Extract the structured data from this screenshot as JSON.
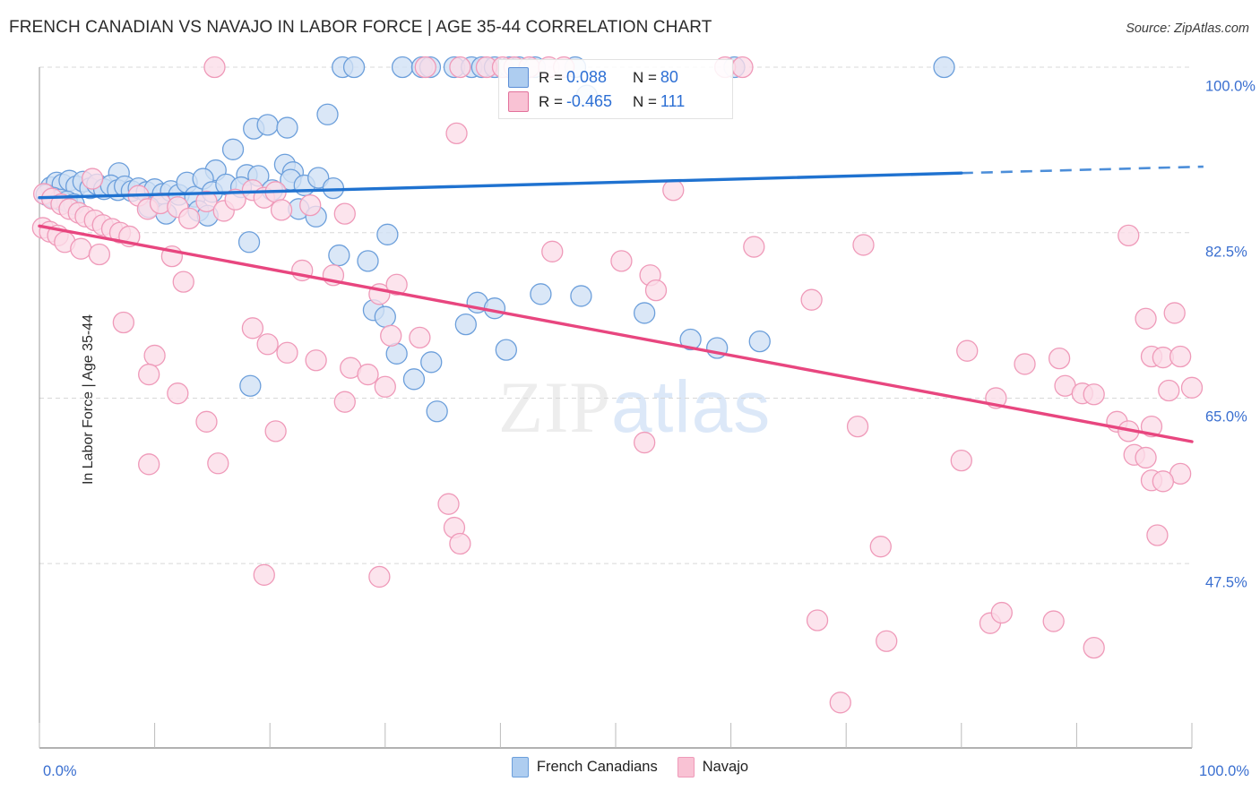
{
  "header": {
    "title": "FRENCH CANADIAN VS NAVAJO IN LABOR FORCE | AGE 35-44 CORRELATION CHART",
    "source": "Source: ZipAtlas.com"
  },
  "watermark": {
    "part1": "ZIP",
    "part2": "atlas"
  },
  "stats_legend": {
    "rows": [
      {
        "swatch": "blue-swatch",
        "r_label": "R =",
        "r_value": "0.088",
        "n_label": "N =",
        "n_value": "80"
      },
      {
        "swatch": "pink-swatch",
        "r_label": "R =",
        "r_value": "-0.465",
        "n_label": "N =",
        "n_value": "111"
      }
    ]
  },
  "series_legend": [
    {
      "name": "French Canadians",
      "color": "#aecdf0"
    },
    {
      "name": "Navajo",
      "color": "#f9c2d4"
    }
  ],
  "colors": {
    "blue_fill": "#cfe0f5",
    "blue_stroke": "#6c9fdb",
    "pink_fill": "#fbdde8",
    "pink_stroke": "#ef9ab9",
    "blue_line": "#1f72d0",
    "pink_line": "#e8467f",
    "axis_label": "#3a6fd0",
    "gridline": "#d8d8d8"
  },
  "chart_data": {
    "type": "scatter",
    "title": "FRENCH CANADIAN VS NAVAJO IN LABOR FORCE | AGE 35-44 CORRELATION CHART",
    "xlabel": "",
    "ylabel": "In Labor Force | Age 35-44",
    "xlim": [
      0,
      100
    ],
    "ylim": [
      28.0,
      100.0
    ],
    "x_tick_labels": [
      "0.0%",
      "100.0%"
    ],
    "y_tick_labels": [
      "100.0%",
      "82.5%",
      "65.0%",
      "47.5%"
    ],
    "y_ticks": [
      100.0,
      82.5,
      65.0,
      47.5
    ],
    "grid": true,
    "legend_position": "bottom-center",
    "series": [
      {
        "name": "French Canadians",
        "color": "#cfe0f5",
        "stroke": "#6c9fdb",
        "R": 0.088,
        "N": 80,
        "trendline": {
          "x0": 0,
          "y0": 86.2,
          "x1": 80,
          "y1": 88.8,
          "dashed_from_x": 80,
          "x_dash_end": 101
        },
        "points": [
          [
            26.3,
            100.0
          ],
          [
            27.3,
            100.0
          ],
          [
            31.5,
            100.0
          ],
          [
            33.2,
            100.0
          ],
          [
            33.9,
            100.0
          ],
          [
            36.0,
            100.0
          ],
          [
            37.5,
            100.0
          ],
          [
            38.4,
            100.0
          ],
          [
            39.5,
            100.0
          ],
          [
            40.8,
            100.0
          ],
          [
            41.6,
            100.0
          ],
          [
            43.0,
            100.0
          ],
          [
            46.5,
            100.0
          ],
          [
            60.3,
            100.0
          ],
          [
            78.5,
            100.0
          ],
          [
            47.5,
            97.0
          ],
          [
            18.6,
            93.5
          ],
          [
            19.8,
            93.9
          ],
          [
            21.5,
            93.6
          ],
          [
            25.0,
            95.0
          ],
          [
            16.8,
            91.3
          ],
          [
            21.3,
            89.7
          ],
          [
            15.3,
            89.1
          ],
          [
            18.0,
            88.6
          ],
          [
            22.0,
            88.9
          ],
          [
            6.9,
            88.8
          ],
          [
            1.0,
            87.3
          ],
          [
            1.5,
            87.8
          ],
          [
            2.0,
            87.6
          ],
          [
            2.6,
            88.0
          ],
          [
            3.2,
            87.4
          ],
          [
            3.8,
            87.9
          ],
          [
            4.4,
            87.2
          ],
          [
            5.0,
            87.6
          ],
          [
            5.6,
            87.1
          ],
          [
            6.2,
            87.5
          ],
          [
            6.8,
            87.0
          ],
          [
            7.4,
            87.4
          ],
          [
            8.0,
            86.9
          ],
          [
            8.6,
            87.2
          ],
          [
            9.3,
            86.8
          ],
          [
            10.0,
            87.1
          ],
          [
            10.7,
            86.6
          ],
          [
            11.4,
            86.9
          ],
          [
            12.1,
            86.5
          ],
          [
            12.8,
            87.8
          ],
          [
            13.5,
            86.3
          ],
          [
            14.2,
            88.2
          ],
          [
            15.0,
            86.8
          ],
          [
            16.2,
            87.6
          ],
          [
            17.5,
            87.3
          ],
          [
            19.0,
            88.5
          ],
          [
            20.2,
            87.0
          ],
          [
            21.8,
            88.1
          ],
          [
            23.0,
            87.5
          ],
          [
            24.2,
            88.3
          ],
          [
            25.5,
            87.2
          ],
          [
            0.6,
            86.5
          ],
          [
            1.2,
            86.2
          ],
          [
            1.8,
            86.0
          ],
          [
            2.4,
            85.8
          ],
          [
            3.0,
            85.5
          ],
          [
            9.5,
            85.2
          ],
          [
            11.0,
            84.5
          ],
          [
            13.8,
            84.8
          ],
          [
            14.6,
            84.3
          ],
          [
            22.5,
            85.0
          ],
          [
            24.0,
            84.2
          ],
          [
            18.2,
            81.5
          ],
          [
            26.0,
            80.1
          ],
          [
            28.5,
            79.5
          ],
          [
            30.2,
            82.3
          ],
          [
            38.0,
            75.1
          ],
          [
            39.5,
            74.5
          ],
          [
            29.0,
            74.3
          ],
          [
            30.0,
            73.6
          ],
          [
            37.0,
            72.8
          ],
          [
            40.5,
            70.1
          ],
          [
            31.0,
            69.7
          ],
          [
            34.0,
            68.8
          ],
          [
            32.5,
            67.0
          ],
          [
            58.8,
            70.3
          ],
          [
            34.5,
            63.6
          ],
          [
            18.3,
            66.3
          ],
          [
            43.5,
            76.0
          ],
          [
            47.0,
            75.8
          ],
          [
            52.5,
            74.0
          ],
          [
            56.5,
            71.2
          ],
          [
            62.5,
            71.0
          ]
        ]
      },
      {
        "name": "Navajo",
        "color": "#fbdde8",
        "stroke": "#ef9ab9",
        "R": -0.465,
        "N": 111,
        "trendline": {
          "x0": 0,
          "y0": 83.2,
          "x1": 100,
          "y1": 60.4
        },
        "points": [
          [
            15.2,
            100.0
          ],
          [
            33.5,
            100.0
          ],
          [
            36.5,
            100.0
          ],
          [
            38.8,
            100.0
          ],
          [
            40.2,
            100.0
          ],
          [
            41.2,
            100.0
          ],
          [
            42.5,
            100.0
          ],
          [
            44.2,
            100.0
          ],
          [
            45.5,
            100.0
          ],
          [
            59.5,
            100.0
          ],
          [
            61.0,
            100.0
          ],
          [
            36.2,
            93.0
          ],
          [
            0.4,
            86.6
          ],
          [
            1.1,
            86.1
          ],
          [
            1.9,
            85.5
          ],
          [
            4.6,
            88.2
          ],
          [
            2.6,
            85.0
          ],
          [
            3.4,
            84.6
          ],
          [
            4.0,
            84.2
          ],
          [
            4.8,
            83.8
          ],
          [
            5.5,
            83.3
          ],
          [
            6.3,
            82.9
          ],
          [
            7.0,
            82.5
          ],
          [
            7.8,
            82.1
          ],
          [
            8.6,
            86.4
          ],
          [
            9.4,
            85.0
          ],
          [
            10.5,
            85.6
          ],
          [
            12.0,
            85.2
          ],
          [
            13.0,
            84.0
          ],
          [
            14.5,
            85.8
          ],
          [
            16.0,
            84.8
          ],
          [
            17.0,
            86.0
          ],
          [
            18.5,
            87.0
          ],
          [
            19.5,
            86.2
          ],
          [
            20.5,
            86.8
          ],
          [
            21.0,
            84.9
          ],
          [
            23.5,
            85.4
          ],
          [
            26.5,
            84.5
          ],
          [
            55.0,
            87.0
          ],
          [
            0.3,
            83.0
          ],
          [
            0.9,
            82.6
          ],
          [
            1.6,
            82.2
          ],
          [
            2.2,
            81.5
          ],
          [
            3.6,
            80.8
          ],
          [
            5.2,
            80.2
          ],
          [
            11.5,
            80.0
          ],
          [
            44.5,
            80.5
          ],
          [
            50.5,
            79.5
          ],
          [
            53.0,
            78.0
          ],
          [
            62.0,
            81.0
          ],
          [
            71.5,
            81.2
          ],
          [
            94.5,
            82.2
          ],
          [
            22.8,
            78.5
          ],
          [
            25.5,
            78.0
          ],
          [
            12.5,
            77.3
          ],
          [
            29.5,
            76.0
          ],
          [
            31.0,
            77.0
          ],
          [
            53.5,
            76.4
          ],
          [
            67.0,
            75.4
          ],
          [
            98.5,
            74.0
          ],
          [
            96.0,
            73.4
          ],
          [
            7.3,
            73.0
          ],
          [
            18.5,
            72.4
          ],
          [
            30.5,
            71.6
          ],
          [
            33.0,
            71.4
          ],
          [
            19.8,
            70.7
          ],
          [
            10.0,
            69.5
          ],
          [
            21.5,
            69.8
          ],
          [
            24.0,
            69.0
          ],
          [
            9.5,
            67.5
          ],
          [
            27.0,
            68.2
          ],
          [
            28.5,
            67.5
          ],
          [
            80.5,
            70.0
          ],
          [
            85.5,
            68.6
          ],
          [
            88.5,
            69.2
          ],
          [
            96.5,
            69.4
          ],
          [
            97.5,
            69.3
          ],
          [
            99.0,
            69.4
          ],
          [
            30.0,
            66.2
          ],
          [
            12.0,
            65.5
          ],
          [
            26.5,
            64.6
          ],
          [
            89.0,
            66.3
          ],
          [
            90.5,
            65.5
          ],
          [
            91.5,
            65.4
          ],
          [
            100.0,
            66.1
          ],
          [
            98.0,
            65.8
          ],
          [
            83.0,
            65.0
          ],
          [
            14.5,
            62.5
          ],
          [
            20.5,
            61.5
          ],
          [
            71.0,
            62.0
          ],
          [
            93.5,
            62.5
          ],
          [
            94.5,
            61.5
          ],
          [
            96.5,
            62.0
          ],
          [
            52.5,
            60.3
          ],
          [
            9.5,
            58.0
          ],
          [
            15.5,
            58.1
          ],
          [
            80.0,
            58.4
          ],
          [
            95.0,
            59.0
          ],
          [
            96.0,
            58.7
          ],
          [
            99.0,
            57.0
          ],
          [
            96.5,
            56.3
          ],
          [
            97.5,
            56.2
          ],
          [
            35.5,
            53.8
          ],
          [
            36.0,
            51.3
          ],
          [
            36.5,
            49.6
          ],
          [
            97.0,
            50.5
          ],
          [
            73.0,
            49.3
          ],
          [
            19.5,
            46.3
          ],
          [
            29.5,
            46.1
          ],
          [
            67.5,
            41.5
          ],
          [
            82.5,
            41.2
          ],
          [
            83.5,
            42.3
          ],
          [
            88.0,
            41.4
          ],
          [
            73.5,
            39.3
          ],
          [
            91.5,
            38.6
          ],
          [
            69.5,
            32.8
          ]
        ]
      }
    ]
  }
}
